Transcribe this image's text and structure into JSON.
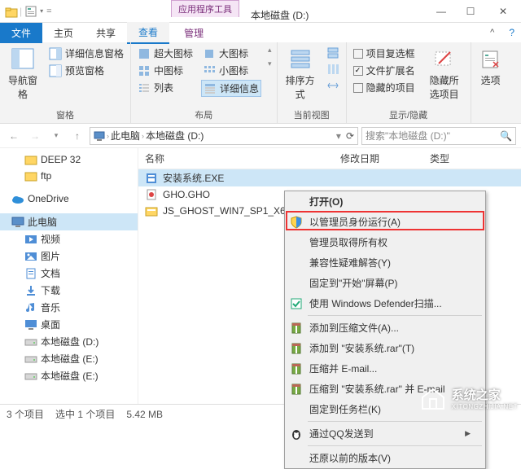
{
  "window": {
    "context_tab_category": "应用程序工具",
    "title": "本地磁盘 (D:)"
  },
  "ribbon_tabs": {
    "file": "文件",
    "home": "主页",
    "share": "共享",
    "view": "查看",
    "manage": "管理"
  },
  "ribbon": {
    "panes": {
      "nav_pane": "导航窗格",
      "preview_pane": "预览窗格",
      "detail_pane": "详细信息窗格",
      "group": "窗格"
    },
    "layout": {
      "extra_large": "超大图标",
      "large": "大图标",
      "medium": "中图标",
      "small": "小图标",
      "list": "列表",
      "details": "详细信息",
      "group": "布局"
    },
    "current": {
      "sort": "排序方式",
      "group": "当前视图"
    },
    "showhide": {
      "item_checkboxes": "项目复选框",
      "file_ext": "文件扩展名",
      "hidden_items": "隐藏的项目",
      "hide": "隐藏所选项目",
      "group": "显示/隐藏"
    },
    "options": "选项"
  },
  "address": {
    "pc": "此电脑",
    "drive": "本地磁盘 (D:)",
    "search_placeholder": "搜索\"本地磁盘 (D:)\""
  },
  "tree": {
    "deep32": "DEEP 32",
    "ftp": "ftp",
    "onedrive": "OneDrive",
    "this_pc": "此电脑",
    "videos": "视频",
    "pictures": "图片",
    "documents": "文档",
    "downloads": "下载",
    "music": "音乐",
    "desktop": "桌面",
    "drive_d1": "本地磁盘 (D:)",
    "drive_d2": "本地磁盘 (E:)",
    "drive_d3": "本地磁盘 (E:)"
  },
  "list": {
    "headers": {
      "name": "名称",
      "date": "修改日期",
      "type": "类型"
    },
    "rows": [
      {
        "name": "安装系统.EXE"
      },
      {
        "name": "GHO.GHO"
      },
      {
        "name": "JS_GHOST_WIN7_SP1_X64_..."
      }
    ]
  },
  "context_menu": {
    "open": "打开(O)",
    "run_as_admin": "以管理员身份运行(A)",
    "take_owner": "管理员取得所有权",
    "compat": "兼容性疑难解答(Y)",
    "pin_start": "固定到\"开始\"屏幕(P)",
    "defender": "使用 Windows Defender扫描...",
    "add_archive": "添加到压缩文件(A)...",
    "add_rar": "添加到 \"安装系统.rar\"(T)",
    "compress_email": "压缩并 E-mail...",
    "compress_rar_email": "压缩到 \"安装系统.rar\" 并 E-mail",
    "pin_taskbar": "固定到任务栏(K)",
    "send_qq": "通过QQ发送到",
    "restore_prev": "还原以前的版本(V)"
  },
  "status": {
    "items": "3 个项目",
    "selected": "选中 1 个项目",
    "size": "5.42 MB"
  },
  "watermark": {
    "name": "系统之家",
    "url": "XITONGZHIJIA.NET"
  }
}
